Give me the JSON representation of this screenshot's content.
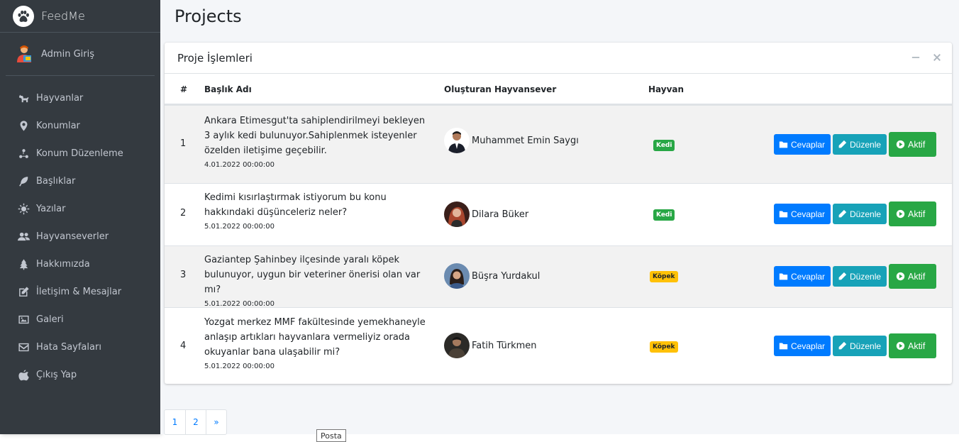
{
  "brand": {
    "name": "FeedMe",
    "logo_icon": "paw-icon"
  },
  "user": {
    "name": "Admin Giriş"
  },
  "sidebar": {
    "items": [
      {
        "label": "Hayvanlar",
        "icon": "dog-icon"
      },
      {
        "label": "Konumlar",
        "icon": "map-marker-icon"
      },
      {
        "label": "Konum Düzenleme",
        "icon": "route-icon"
      },
      {
        "label": "Başlıklar",
        "icon": "feather-icon"
      },
      {
        "label": "Yazılar",
        "icon": "sun-icon"
      },
      {
        "label": "Hayvanseverler",
        "icon": "users-icon"
      },
      {
        "label": "Hakkımızda",
        "icon": "tree-icon"
      },
      {
        "label": "İletişim & Mesajlar",
        "icon": "edit-icon"
      },
      {
        "label": "Galeri",
        "icon": "image-icon"
      },
      {
        "label": "Hata Sayfaları",
        "icon": "envelope-icon"
      },
      {
        "label": "Çıkış Yap",
        "icon": "apple-icon"
      }
    ]
  },
  "page": {
    "title": "Projects"
  },
  "card": {
    "title": "Proje İşlemleri",
    "minimize_icon": "minus-icon",
    "close_icon": "times-icon"
  },
  "table": {
    "headers": {
      "num": "#",
      "title": "Başlık Adı",
      "creator": "Oluşturan Hayvansever",
      "animal": "Hayvan"
    },
    "rows": [
      {
        "num": "1",
        "title": "Ankara Etimesgut'ta sahiplendirilmeyi bekleyen 3 aylık kedi bulunuyor.Sahiplenmek isteyenler özelden iletişime geçebilir.",
        "date": "4.01.2022 00:00:00",
        "creator": "Muhammet Emin Saygı",
        "animal": "Kedi"
      },
      {
        "num": "2",
        "title": "Kedimi kısırlaştırmak istiyorum bu konu hakkındaki düşünceleriz neler?",
        "date": "5.01.2022 00:00:00",
        "creator": "Dilara Büker",
        "animal": "Kedi"
      },
      {
        "num": "3",
        "title": "Gaziantep Şahinbey ilçesinde yaralı köpek bulunuyor, uygun bir veteriner önerisi olan var mı?",
        "date": "5.01.2022 00:00:00",
        "creator": "Büşra Yurdakul",
        "animal": "Köpek"
      },
      {
        "num": "4",
        "title": "Yozgat merkez MMF fakültesinde yemekhaneyle anlaşıp artıkları hayvanlara vermeliyiz orada okuyanlar bana ulaşabilir mi?",
        "date": "5.01.2022 00:00:00",
        "creator": "Fatih Türkmen",
        "animal": "Köpek"
      }
    ],
    "actions": {
      "answers": "Cevaplar",
      "edit": "Düzenle",
      "active": "Aktif"
    }
  },
  "pagination": {
    "pages": [
      "1",
      "2"
    ],
    "next": "»"
  },
  "tooltip": {
    "text": "Posta"
  },
  "colors": {
    "sidebar_bg": "#343a40",
    "primary": "#007bff",
    "info": "#17a2b8",
    "success": "#28a745",
    "warning": "#ffc107"
  }
}
